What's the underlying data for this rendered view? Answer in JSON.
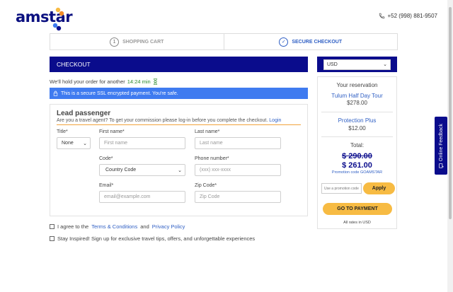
{
  "header": {
    "logo_text": "amstar",
    "phone": "+52 (998) 881-9507"
  },
  "steps": [
    {
      "number": "1",
      "label": "SHOPPING CART"
    },
    {
      "number": "✓",
      "label": "SECURE CHECKOUT"
    }
  ],
  "checkout": {
    "title": "CHECKOUT",
    "hold_prefix": "We'll hold your order for another",
    "hold_time": "14:24 min",
    "ssl_text": "This is a secure SSL encrypted payment. You're safe."
  },
  "lead": {
    "title": "Lead passenger",
    "agent_text": "Are you a travel agent? To get your commission please log-in before you complete the checkout.",
    "login_link": "Login",
    "title_label": "Title*",
    "title_value": "None",
    "first_label": "First name*",
    "first_placeholder": "First name",
    "last_label": "Last name*",
    "last_placeholder": "Last name",
    "code_label": "Code*",
    "code_value": "Country Code",
    "phone_label": "Phone number*",
    "phone_placeholder": "(xxx) xxx-xxxx",
    "email_label": "Email*",
    "email_placeholder": "email@example.com",
    "zip_label": "Zip Code*",
    "zip_placeholder": "Zip Code"
  },
  "consent": {
    "terms_prefix": "I agree to the",
    "terms_link": "Terms & Conditions",
    "terms_and": "and",
    "privacy_link": "Privacy Policy",
    "newsletter": "Stay Inspired! Sign up for exclusive travel tips, offers, and unforgettable experiences"
  },
  "summary": {
    "currency": "USD",
    "reservation_title": "Your reservation",
    "tour_name": "Tulum Half Day Tour",
    "tour_price": "$278.00",
    "protection_name": "Protection Plus",
    "protection_price": "$12.00",
    "total_label": "Total:",
    "old_total": "$ 290.00",
    "new_total": "$ 261.00",
    "promo_prefix": "Promotion code",
    "promo_code": "GOAMSTAR",
    "promo_placeholder": "Use a promotion code",
    "apply_label": "Apply",
    "pay_label": "GO TO PAYMENT",
    "rates_note": "All rates in USD"
  },
  "feedback_label": "Online Feedback",
  "colors": {
    "brand_navy": "#0a0c8c",
    "accent_yellow": "#f7bb43",
    "link_blue": "#2f5fc4",
    "ssl_blue": "#3f7bf0"
  }
}
